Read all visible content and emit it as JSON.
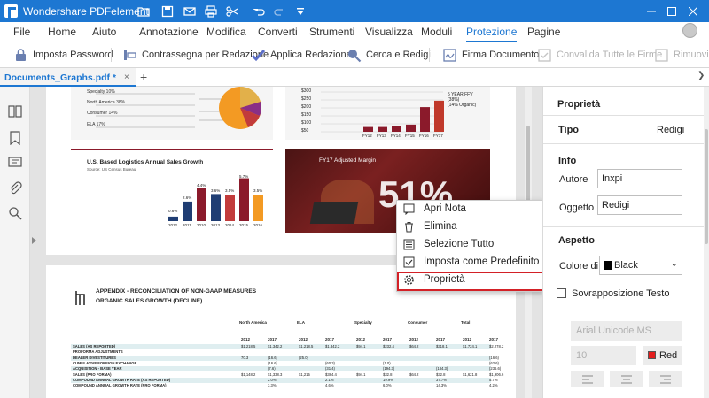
{
  "app": {
    "title": "Wondershare PDFelement"
  },
  "menu": [
    "File",
    "Home",
    "Aiuto",
    "Annotazione",
    "Modifica",
    "Converti",
    "Strumenti",
    "Visualizza",
    "Moduli",
    "Protezione",
    "Pagine"
  ],
  "ribbon": {
    "imposta_password": "Imposta Password",
    "contrassegna": "Contrassegna per Redazione",
    "applica": "Applica Redazione",
    "cerca": "Cerca e Redigi",
    "firma": "Firma Documento",
    "convalida": "Convalida Tutte le Firme",
    "rimuovi": "Rimuovi"
  },
  "tab": {
    "name": "Documents_Graphs.pdf *",
    "close": "×",
    "add": "+"
  },
  "page1": {
    "pie_legend": [
      "Specialty 10%",
      "North America 38%",
      "Consumer 14%",
      "ELA 17%"
    ],
    "bar_axis": [
      "$300",
      "$250",
      "$200",
      "$150",
      "$100",
      "$50"
    ],
    "bar_x": [
      "FY12",
      "FY13",
      "FY14",
      "FY15",
      "FY16",
      "FY17"
    ],
    "bar_note": [
      "5 YEAR FFV",
      "(38%)",
      "(14% Organic)"
    ],
    "logistics_title": "U.S. Based Logistics Annual Sales Growth",
    "logistics_source": "Source: US Census Bureau",
    "logistics_years": [
      "2012",
      "2011",
      "2010",
      "2013",
      "2014",
      "2015",
      "2016"
    ],
    "logistics_vals": [
      "0.6%",
      "2.6%",
      "4.4%",
      "3.6%",
      "3.5%",
      "5.7%",
      "3.5%"
    ],
    "margin_title": "FY17 Adjusted Margin",
    "margin_big": "51%"
  },
  "page2": {
    "title1": "APPENDIX - RECONCILIATION OF NON-GAAP MEASURES",
    "title2": "ORGANIC SALES GROWTH (DECLINE)",
    "groups": [
      "North America",
      "ELA",
      "Specialty",
      "Consumer",
      "Total"
    ],
    "years": [
      "2012",
      "2017",
      "2012",
      "2017",
      "2012",
      "2017",
      "2012",
      "2017",
      "2012",
      "2017"
    ],
    "rows": [
      {
        "label": "SALES (AS REPORTED)",
        "cells": [
          "$1,218.5",
          "$1,342.2",
          "$1,218.5",
          "$1,342.2",
          "$94.1",
          "$232.4",
          "$64.2",
          "$318.1",
          "$1,724.1",
          "$2,278.2"
        ]
      },
      {
        "label": "PROFORMA ADJUSTMENTS",
        "cells": [
          "",
          "",
          "",
          "",
          "",
          "",
          "",
          "",
          "",
          ""
        ]
      },
      {
        "label": "DEALER DIVESTITURES",
        "cells": [
          "70.3",
          "(16.6)",
          "(25.0)",
          "",
          "",
          "",
          "",
          "",
          "",
          "(16.6)"
        ]
      },
      {
        "label": "CUMULATIVE FOREIGN EXCHANGE",
        "cells": [
          "",
          "(16.6)",
          "",
          "(60.3)",
          "",
          "(1.0)",
          "",
          "",
          "",
          "(62.6)"
        ]
      },
      {
        "label": "ACQUISITION - BASE YEAR",
        "cells": [
          "",
          "(7.6)",
          "",
          "(31.4)",
          "",
          "(194.3)",
          "",
          "(184.3)",
          "",
          "(236.6)"
        ]
      },
      {
        "label": "SALES (PRO FORMA)",
        "cells": [
          "$1,148.2",
          "$1,338.3",
          "$1,215",
          "$384.4",
          "$94.1",
          "$32.8",
          "$64.2",
          "$32.8",
          "$1,621.8",
          "$1,906.6"
        ]
      },
      {
        "label": "COMPOUND ANNUAL GROWTH RATE (AS REPORTED)",
        "cells": [
          "",
          "2.0%",
          "",
          "2.1%",
          "",
          "19.9%",
          "",
          "37.7%",
          "",
          "5.7%"
        ]
      },
      {
        "label": "COMPOUND ANNUAL GROWTH RATE (PRO FORMA)",
        "cells": [
          "",
          "3.3%",
          "",
          "4.6%",
          "",
          "6.0%",
          "",
          "14.3%",
          "",
          "4.2%"
        ]
      }
    ]
  },
  "context_menu": [
    "Apri Nota",
    "Elimina",
    "Selezione Tutto",
    "Imposta come Predefinito",
    "Proprietà"
  ],
  "props": {
    "heading": "Proprietà",
    "tipo_label": "Tipo",
    "tipo_value": "Redigi",
    "info": "Info",
    "autore_label": "Autore",
    "autore_value": "Inxpi",
    "oggetto_label": "Oggetto",
    "oggetto_value": "Redigi",
    "aspetto": "Aspetto",
    "colore_label": "Colore di Riempimento",
    "colore_value": "Black",
    "sovrapposizione": "Sovrapposizione Testo",
    "font": "Arial Unicode MS",
    "size": "10",
    "text_color": "Red"
  },
  "colors": {
    "accent": "#1d77d2",
    "highlight": "#d32026",
    "bar_dark": "#8b1a2b",
    "bar_red": "#c0392b"
  }
}
